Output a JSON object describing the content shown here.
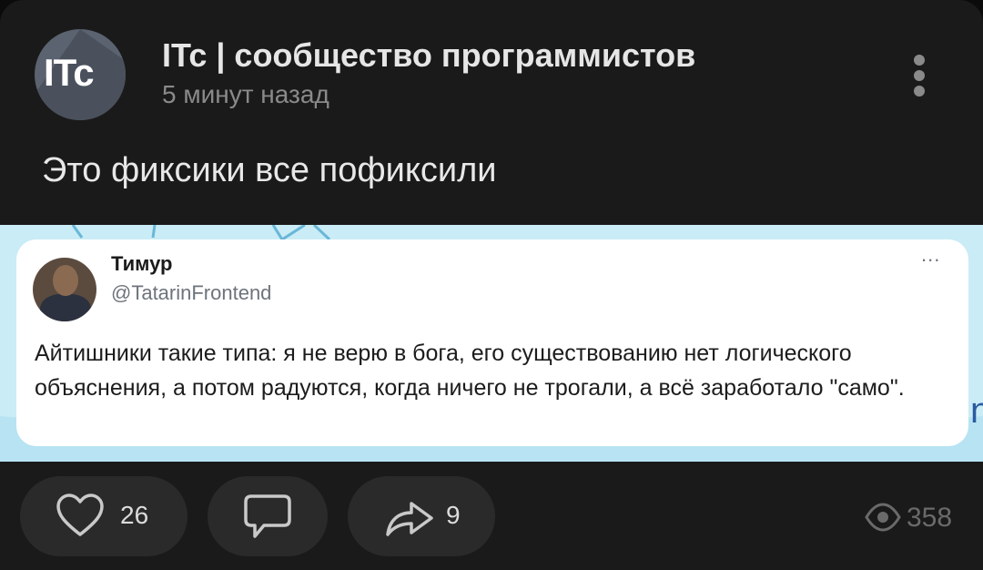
{
  "post": {
    "channel_name": "ITc | сообщество программистов",
    "avatar_text": "ITc",
    "time_ago": "5 минут назад",
    "caption": "Это фиксики все пофиксили"
  },
  "tweet": {
    "author_name": "Тимур",
    "author_handle": "@TatarinFrontend",
    "more_label": "...",
    "text": "Айтишники такие типа: я не верю в бога, его существованию нет логического объяснения, а потом радуются, когда ничего не трогали, а всё заработало \"само\".",
    "edge_letter": "n"
  },
  "actions": {
    "likes": "26",
    "shares": "9",
    "views": "358"
  },
  "icons": {
    "menu": "kebab-menu-icon",
    "like": "heart-icon",
    "comment": "comment-icon",
    "share": "share-arrow-icon",
    "views": "eye-icon"
  },
  "colors": {
    "background": "#1a1a1a",
    "pill": "#2a2a2a",
    "image_bg": "#c9ecf6",
    "accent": "#2a5ba0"
  }
}
